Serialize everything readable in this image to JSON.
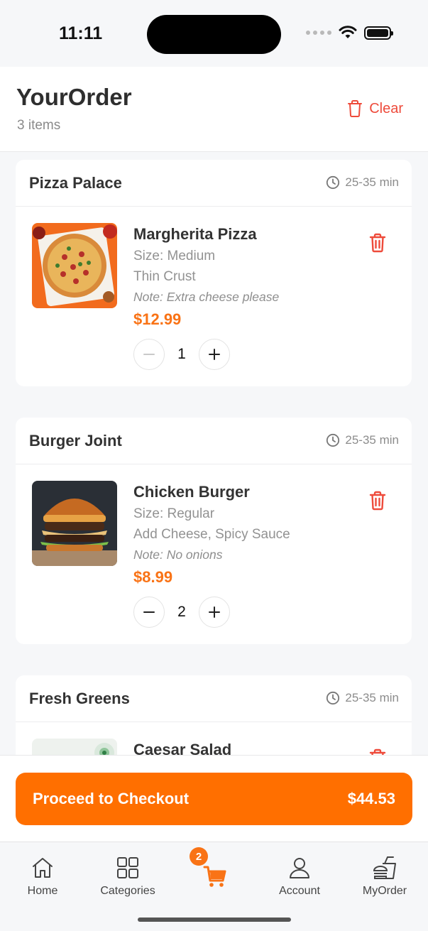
{
  "status_bar": {
    "time": "11:11"
  },
  "header": {
    "title": "YourOrder",
    "item_count": "3 items",
    "clear_label": "Clear"
  },
  "restaurants": [
    {
      "name": "Pizza Palace",
      "eta": "25-35 min",
      "item": {
        "name": "Margherita Pizza",
        "line1": "Size: Medium",
        "line2": "Thin Crust",
        "note": "Note: Extra cheese please",
        "price": "$12.99",
        "quantity": "1"
      }
    },
    {
      "name": "Burger Joint",
      "eta": "25-35 min",
      "item": {
        "name": "Chicken Burger",
        "line1": "Size: Regular",
        "line2": "Add Cheese, Spicy Sauce",
        "note": "Note: No onions",
        "price": "$8.99",
        "quantity": "2"
      }
    },
    {
      "name": "Fresh Greens",
      "eta": "25-35 min",
      "item": {
        "name": "Caesar Salad"
      }
    }
  ],
  "checkout": {
    "label": "Proceed to Checkout",
    "total": "$44.53"
  },
  "tabs": [
    {
      "label": "Home",
      "icon": "home-icon"
    },
    {
      "label": "Categories",
      "icon": "grid-icon"
    },
    {
      "label": "",
      "icon": "cart-icon",
      "badge": "2",
      "active": true
    },
    {
      "label": "Account",
      "icon": "user-icon"
    },
    {
      "label": "MyOrder",
      "icon": "fast-food-icon"
    }
  ],
  "colors": {
    "accent": "#ff6f00",
    "danger": "#ee4b3b",
    "price": "#f97316"
  }
}
